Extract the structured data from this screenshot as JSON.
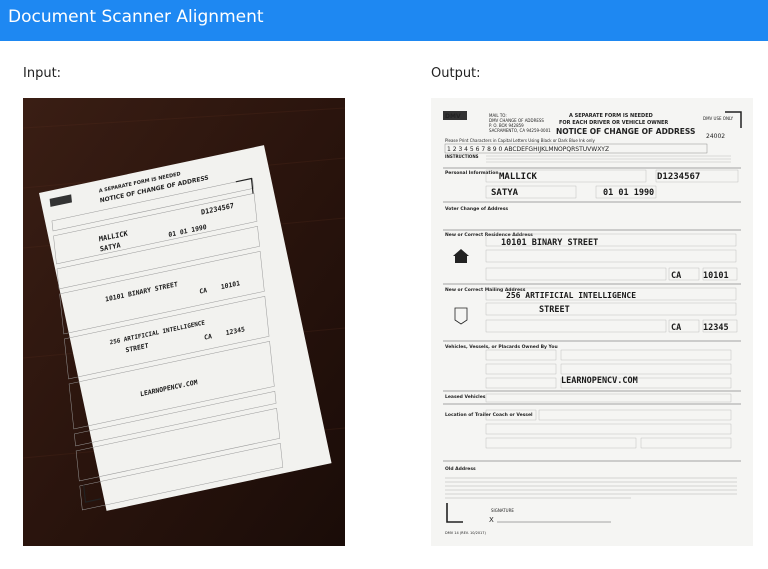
{
  "app": {
    "title": "Document Scanner Alignment",
    "accent": "#1e88f2"
  },
  "panels": {
    "input_label": "Input:",
    "output_label": "Output:"
  },
  "form": {
    "agency": "DMV",
    "mail_to": "MAIL TO:",
    "dmv_change": "DMV CHANGE OF ADDRESS",
    "po_box": "P. O. BOX 942859",
    "city": "SACRAMENTO, CA 94259-0001",
    "header_line1": "A SEPARATE FORM IS NEEDED",
    "header_line2": "FOR EACH DRIVER OR VEHICLE OWNER",
    "form_title": "NOTICE OF CHANGE OF ADDRESS",
    "office_use": "DMV USE ONLY",
    "form_number": "24002",
    "print_note": "Please Print Characters in Capital Letters Using Black or Dark Blue Ink only",
    "instructions": "INSTRUCTIONS",
    "personal_info": "Personal Information",
    "voter_change": "Voter Change of Address",
    "residence_address": "New or Correct Residence Address",
    "mailing_address": "New or Correct Mailing Address",
    "vehicles": "Vehicles, Vessels, or Placards Owned By You",
    "leased_vehicles": "Leased Vehicles",
    "trailer_location": "Location of Trailer Coach or Vessel",
    "old_address": "Old Address",
    "signature": "SIGNATURE",
    "footer_code": "DMV 14 (REV. 10/2017)",
    "handwriting": {
      "name": "MALLICK",
      "first_name": "SATYA",
      "license": "D1234567",
      "birth_date": "01 01 1990",
      "residence_street": "10101 BINARY STREET",
      "residence_state": "CA",
      "residence_zip": "10101",
      "mailing_line1": "256 ARTIFICIAL INTELLIGENCE",
      "mailing_line2": "STREET",
      "mailing_state": "CA",
      "mailing_zip": "12345",
      "vehicle_note": "LEARNOPENCV.COM"
    }
  }
}
